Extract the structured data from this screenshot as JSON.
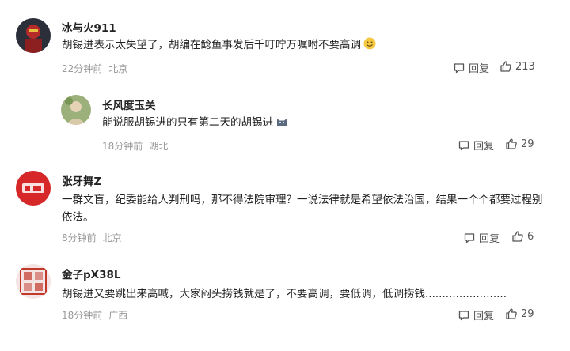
{
  "comments": [
    {
      "username": "冰与火911",
      "text": "胡锡进表示太失望了，胡编在鲶鱼事发后千叮咛万嘱咐不要高调",
      "emoji": "grinning-emoji",
      "time": "22分钟前",
      "location": "北京",
      "reply_label": "回复",
      "likes": "213"
    },
    {
      "username": "长风度玉关",
      "text": "能说服胡锡进的只有第二天的胡锡进",
      "emoji": "cat-emoji",
      "time": "18分钟前",
      "location": "湖北",
      "reply_label": "回复",
      "likes": "29"
    },
    {
      "username": "张牙舞Z",
      "text_line1": "一群文盲，纪委能给人判刑吗，那不得法院审理？一说法律就是希望依法治国，结果一个个都要过程别",
      "text_line2": "依法。",
      "time": "8分钟前",
      "location": "北京",
      "reply_label": "回复",
      "likes": "6"
    },
    {
      "username": "金子pX38L",
      "text": "胡锡进又要跳出来高喊，大家闷头捞钱就是了，不要高调，要低调，低调捞钱........................",
      "time": "18分钟前",
      "location": "广西",
      "reply_label": "回复",
      "likes": "29"
    }
  ],
  "icons": {
    "reply": "comment-bubble-icon",
    "like": "thumbs-up-icon"
  },
  "colors": {
    "text": "#222222",
    "meta": "#999999",
    "action": "#555555"
  }
}
